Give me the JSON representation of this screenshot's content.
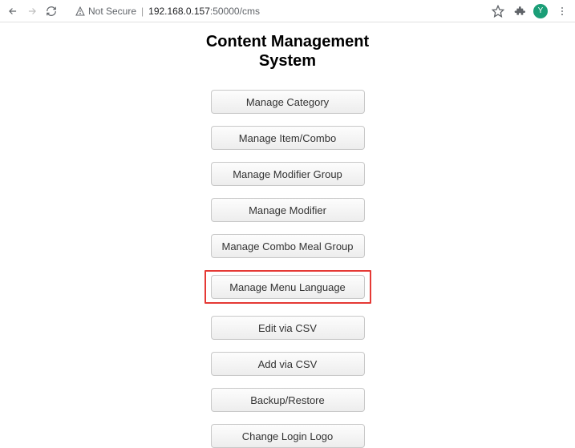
{
  "toolbar": {
    "security_label": "Not Secure",
    "url_host": "192.168.0.157",
    "url_port_path": ":50000/cms",
    "avatar_letter": "Y"
  },
  "page": {
    "title": "Content Management\nSystem"
  },
  "highlighted_index": 5,
  "buttons": [
    {
      "label": "Manage Category",
      "name": "manage-category-button"
    },
    {
      "label": "Manage Item/Combo",
      "name": "manage-item-combo-button"
    },
    {
      "label": "Manage Modifier Group",
      "name": "manage-modifier-group-button"
    },
    {
      "label": "Manage Modifier",
      "name": "manage-modifier-button"
    },
    {
      "label": "Manage Combo Meal Group",
      "name": "manage-combo-meal-group-button"
    },
    {
      "label": "Manage Menu Language",
      "name": "manage-menu-language-button"
    },
    {
      "label": "Edit via CSV",
      "name": "edit-via-csv-button"
    },
    {
      "label": "Add via CSV",
      "name": "add-via-csv-button"
    },
    {
      "label": "Backup/Restore",
      "name": "backup-restore-button"
    },
    {
      "label": "Change Login Logo",
      "name": "change-login-logo-button"
    }
  ]
}
